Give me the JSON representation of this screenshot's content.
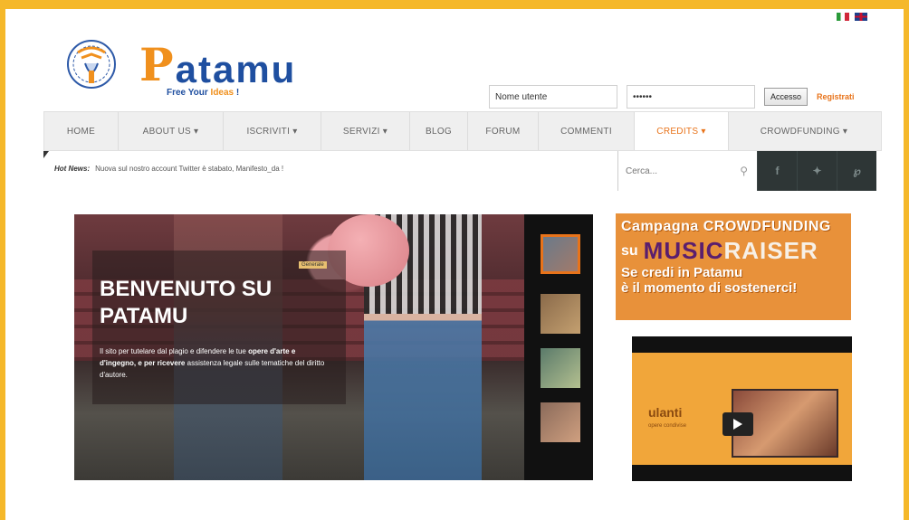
{
  "header": {
    "logo_name": "atamu",
    "logo_initial": "P",
    "tagline_pre": "Free Your",
    "tagline_accent": "Ideas",
    "tagline_post": "!"
  },
  "login": {
    "username_value": "Nome utente",
    "password_value": "••••••",
    "login_label": "Accesso",
    "register_label": "Registrati"
  },
  "nav": {
    "items": [
      {
        "label": "HOME"
      },
      {
        "label": "ABOUT US ▾"
      },
      {
        "label": "ISCRIVITI ▾"
      },
      {
        "label": "SERVIZI ▾"
      },
      {
        "label": "BLOG"
      },
      {
        "label": "FORUM"
      },
      {
        "label": "COMMENTI"
      },
      {
        "label": "CREDITS ▾"
      },
      {
        "label": "CROWDFUNDING ▾"
      }
    ]
  },
  "hotnews": {
    "label": "Hot News:",
    "text": "Nuova sul nostro account Twitter è stabato, Manifesto_da !"
  },
  "search": {
    "placeholder": "Cerca..."
  },
  "social": [
    "f",
    "t",
    "rss"
  ],
  "slider": {
    "tag": "Generale",
    "title": "BENVENUTO SU PATAMU",
    "text_pre": "Il sito per tutelare dal plagio e difendere le tue",
    "text_bold": "opere d'arte e d'ingegno, e per ricevere",
    "text_post": "assistenza legale sulle tematiche del diritto d'autore."
  },
  "promo": {
    "line1": "Campagna CROWDFUNDING",
    "line2_pre": "su",
    "brand_music": "MUSIC",
    "brand_raiser": "RAISER",
    "line3": "Se credi in Patamu",
    "line4": "è il momento di sostenerci!"
  },
  "video": {
    "logo": "ulanti",
    "sub": "opere condivise"
  }
}
